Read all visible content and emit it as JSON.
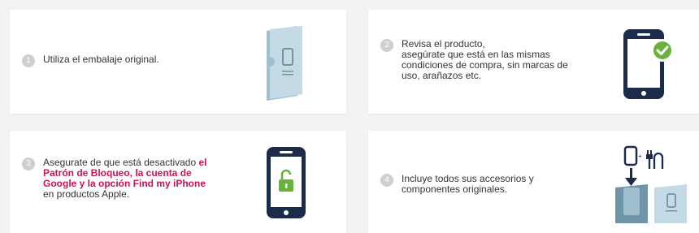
{
  "steps": [
    {
      "number": "1",
      "lines": [
        "Utiliza el embalaje original."
      ]
    },
    {
      "number": "2",
      "lines": [
        "Revisa el producto,",
        "asegúrate que está en las mismas",
        "condiciones de compra, sin marcas de",
        "uso, arañazos etc."
      ]
    },
    {
      "number": "3",
      "prefix": "Asegurate de que está desactivado ",
      "highlight_1": "el",
      "highlight_2": "Patrón de Bloqueo, la cuenta de",
      "highlight_3": "Google y la opción Find my iPhone",
      "suffix": "en productos Apple."
    },
    {
      "number": "4",
      "lines": [
        "Incluye todos sus accesorios y",
        "componentes originales."
      ]
    }
  ],
  "icons": {
    "card1": "package-box-icon",
    "card2": "phone-check-icon",
    "card3": "phone-unlock-icon",
    "card4": "phone-charger-box-icon"
  },
  "colors": {
    "highlight": "#d0124f",
    "phone_dark": "#1d2b4a",
    "check_green": "#6ab23e",
    "box_blue": "#bcd5e0"
  }
}
